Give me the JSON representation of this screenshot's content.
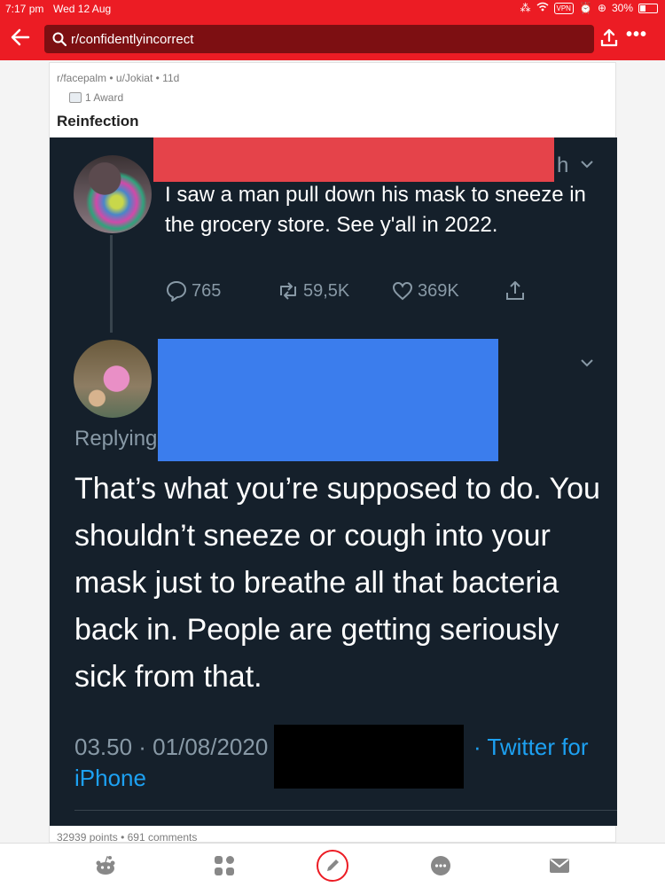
{
  "status_bar": {
    "time": "7:17 pm",
    "date": "Wed 12 Aug",
    "vpn": "VPN",
    "battery": "30%"
  },
  "nav": {
    "search_text": "r/confidentlyincorrect",
    "more": "•••"
  },
  "post": {
    "subreddit": "r/facepalm",
    "user": "u/Jokiat",
    "age": "11d",
    "award": "1 Award",
    "title": "Reinfection",
    "points": "32939 points",
    "comments": "691 comments"
  },
  "image": {
    "tweet1": {
      "handle_fragment": "h",
      "text": "I saw a man pull down his mask to sneeze in the grocery store. See y'all in 2022.",
      "replies": "765",
      "retweets": "59,5K",
      "likes": "369K"
    },
    "tweet2": {
      "replying": "Replying",
      "text": "That’s what you’re supposed to do. You shouldn’t sneeze or cough into your mask just to breathe all that bacteria back in. People are getting seriously sick from that.",
      "timestamp": "03.50 · 01/08/2020",
      "client_line1": "· Twitter for",
      "client_line2": "iPhone"
    }
  },
  "colors": {
    "accent": "#ec1c24",
    "tweet_bg": "#15202b",
    "redact_red": "#e5434a",
    "redact_blue": "#3b7ded",
    "link": "#1da1f2"
  }
}
